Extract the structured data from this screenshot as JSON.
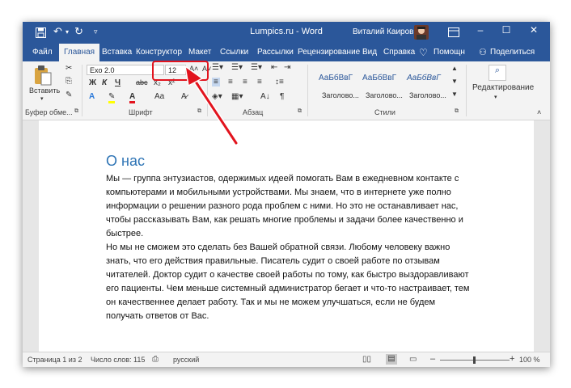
{
  "titlebar": {
    "title": "Lumpics.ru  -  Word",
    "user": "Виталий Каиров",
    "save_icon": "save-icon",
    "undo_icon": "undo-icon",
    "redo_icon": "redo-icon"
  },
  "tabs": [
    "Файл",
    "Главная",
    "Вставка",
    "Конструктор",
    "Макет",
    "Ссылки",
    "Рассылки",
    "Рецензирование",
    "Вид",
    "Справка",
    "Помощн",
    "Поделиться"
  ],
  "ribbon": {
    "clipboard": {
      "paste_label": "Вставить",
      "group_label": "Буфер обме..."
    },
    "font": {
      "font_name": "Exo 2.0",
      "font_size": "12",
      "bold": "Ж",
      "italic": "К",
      "underline": "Ч",
      "strike": "abc",
      "sub": "x₂",
      "sup": "x²",
      "group_label": "Шрифт"
    },
    "paragraph": {
      "group_label": "Абзац"
    },
    "styles": {
      "samples": [
        "АаБбВвГ",
        "АаБбВвГ",
        "АаБбВвГ"
      ],
      "names": [
        "Заголово...",
        "Заголово...",
        "Заголово..."
      ],
      "group_label": "Стили"
    },
    "editing": {
      "label": "Редактирование"
    }
  },
  "document": {
    "heading": "О нас",
    "paragraph1": "Мы — группа энтузиастов, одержимых идеей помогать Вам в ежедневном контакте с компьютерами и мобильными устройствами. Мы знаем, что в интернете уже полно информации о решении разного рода проблем с ними. Но это не останавливает нас, чтобы рассказывать Вам, как решать многие проблемы и задачи более качественно и быстрее.",
    "paragraph2": "Но мы не сможем это сделать без Вашей обратной связи. Любому человеку важно знать, что его действия правильные. Писатель судит о своей работе по отзывам читателей. Доктор судит о качестве своей работы по тому, как быстро выздоравливают его пациенты. Чем меньше системный администратор бегает и что-то настраивает, тем он качественнее делает работу. Так и мы не можем улучшаться, если не будем получать ответов от Вас."
  },
  "statusbar": {
    "page": "Страница 1 из 2",
    "words": "Число слов: 115",
    "language": "русский",
    "zoom": "100 %"
  },
  "colors": {
    "accent": "#2b579a",
    "highlight": "#e2141e",
    "heading": "#2e74b5"
  }
}
